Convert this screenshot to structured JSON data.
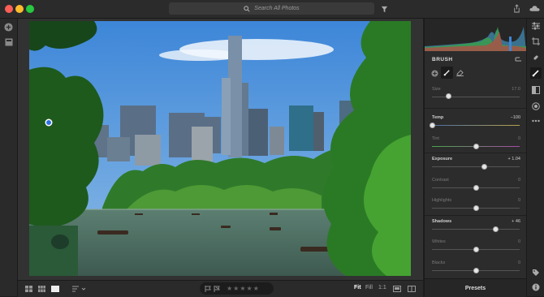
{
  "search": {
    "placeholder": "Search All Photos"
  },
  "colors": {
    "accent": "#2d6fe0",
    "panel_bg": "#2c2c2c",
    "bar_bg": "#2a2a2a"
  },
  "toolbar_icons": [
    "add-icon",
    "library-icon",
    "filter-icon",
    "share-icon",
    "cloud-icon"
  ],
  "panel": {
    "title": "BRUSH",
    "size": {
      "label": "Size",
      "value": "17.0"
    },
    "sliders": [
      {
        "label": "Temp",
        "value": "−100",
        "active": true,
        "position": 0.0
      },
      {
        "label": "Tint",
        "value": "0",
        "active": false,
        "position": 0.5
      },
      {
        "label": "Exposure",
        "value": "+ 1.04",
        "active": true,
        "position": 0.6
      },
      {
        "label": "Contrast",
        "value": "0",
        "active": false,
        "position": 0.5
      },
      {
        "label": "Highlights",
        "value": "0",
        "active": false,
        "position": 0.5
      },
      {
        "label": "Shadows",
        "value": "+ 46",
        "active": true,
        "position": 0.73
      },
      {
        "label": "Whites",
        "value": "0",
        "active": false,
        "position": 0.5
      },
      {
        "label": "Blacks",
        "value": "0",
        "active": false,
        "position": 0.5
      }
    ],
    "presets_label": "Presets"
  },
  "bottom": {
    "fit": "Fit",
    "fill": "Fill",
    "one_to_one": "1:1",
    "rating_stars": 0
  }
}
